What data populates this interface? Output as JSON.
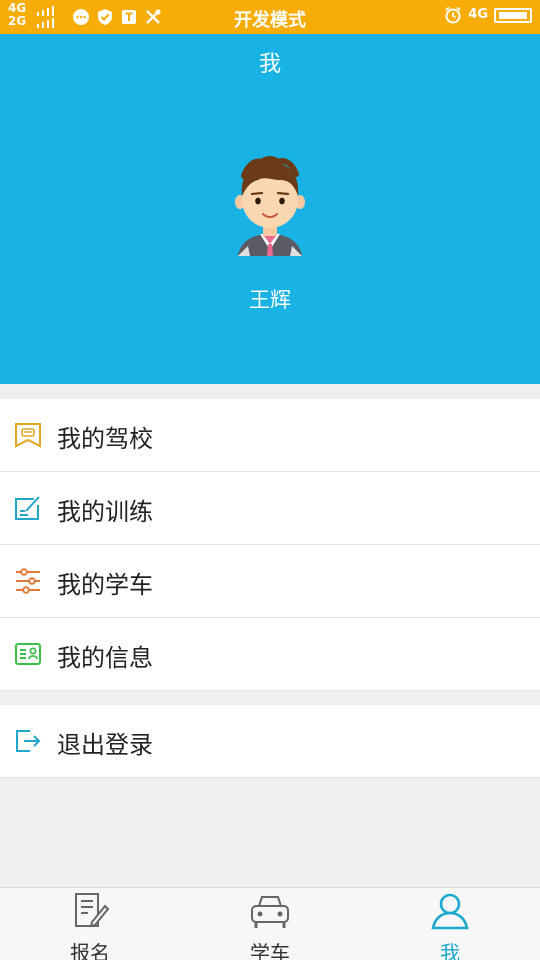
{
  "status_bar": {
    "network_top": "4G",
    "network_bottom": "2G",
    "title": "开发模式",
    "network_right": "4G"
  },
  "header": {
    "title": "我",
    "username": "王辉"
  },
  "menu": {
    "items": [
      {
        "label": "我的驾校",
        "icon": "school-icon"
      },
      {
        "label": "我的训练",
        "icon": "edit-icon"
      },
      {
        "label": "我的学车",
        "icon": "sliders-icon"
      },
      {
        "label": "我的信息",
        "icon": "id-card-icon"
      }
    ],
    "logout": {
      "label": "退出登录",
      "icon": "logout-icon"
    }
  },
  "tabbar": {
    "tabs": [
      {
        "label": "报名",
        "icon": "signup-icon",
        "active": false
      },
      {
        "label": "学车",
        "icon": "car-icon",
        "active": false
      },
      {
        "label": "我",
        "icon": "profile-icon",
        "active": true
      }
    ]
  },
  "colors": {
    "status_bar": "#f7ad05",
    "header": "#19b2e5",
    "active_tab": "#19a7d0"
  }
}
